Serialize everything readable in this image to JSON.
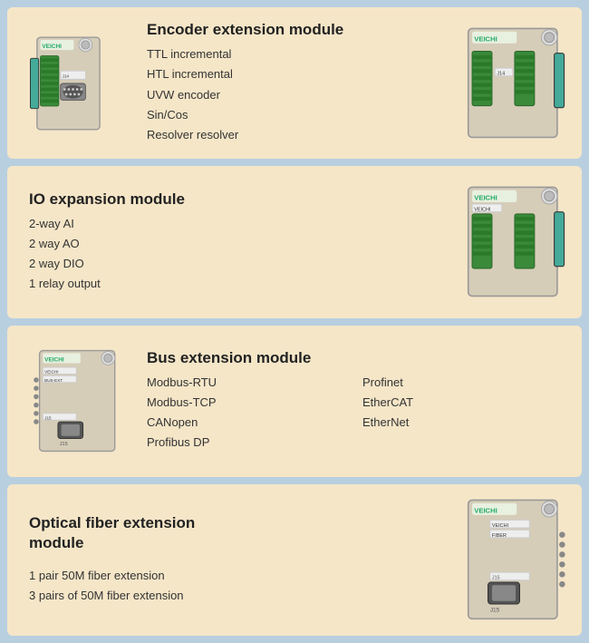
{
  "cards": [
    {
      "id": "encoder",
      "title": "Encoder extension module",
      "features": [
        "TTL incremental",
        "HTL incremental",
        "UVW encoder",
        "Sin/Cos",
        "Resolver resolver"
      ],
      "device_side": "left",
      "has_right_device": true
    },
    {
      "id": "io",
      "title": "IO expansion module",
      "features": [
        "2-way AI",
        "2 way AO",
        "2 way DIO",
        "1 relay output"
      ],
      "device_side": "right",
      "has_right_device": true
    },
    {
      "id": "bus",
      "title": "Bus extension module",
      "features_col1": [
        "Modbus-RTU",
        "Modbus-TCP",
        "CANopen",
        "Profibus DP"
      ],
      "features_col2": [
        "Profinet",
        "EtherCAT",
        "EtherNet",
        ""
      ],
      "device_side": "left",
      "two_col": true
    },
    {
      "id": "optical",
      "title": "Optical fiber extension module",
      "features": [
        "1 pair 50M fiber extension",
        "3 pairs of 50M fiber extension"
      ],
      "device_side": "right",
      "has_right_device": true
    }
  ],
  "brand": "VEICHI"
}
